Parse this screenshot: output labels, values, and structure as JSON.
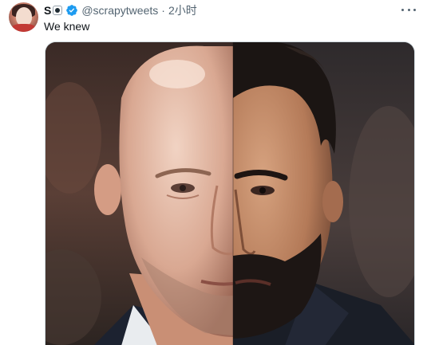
{
  "tweet": {
    "author_name": "S",
    "handle": "@scrapytweets",
    "separator": "·",
    "timestamp": "2小时",
    "text": "We knew",
    "icons": {
      "avatar": "user-avatar",
      "name_emoji": "soccer-ball-icon",
      "verified": "verified-badge-icon",
      "more": "more-options-icon"
    },
    "colors": {
      "verified_blue": "#1d9bf0",
      "text_primary": "#0f1419",
      "text_secondary": "#536471"
    }
  },
  "media": {
    "kind": "photo",
    "subject": "split-face-composite"
  }
}
